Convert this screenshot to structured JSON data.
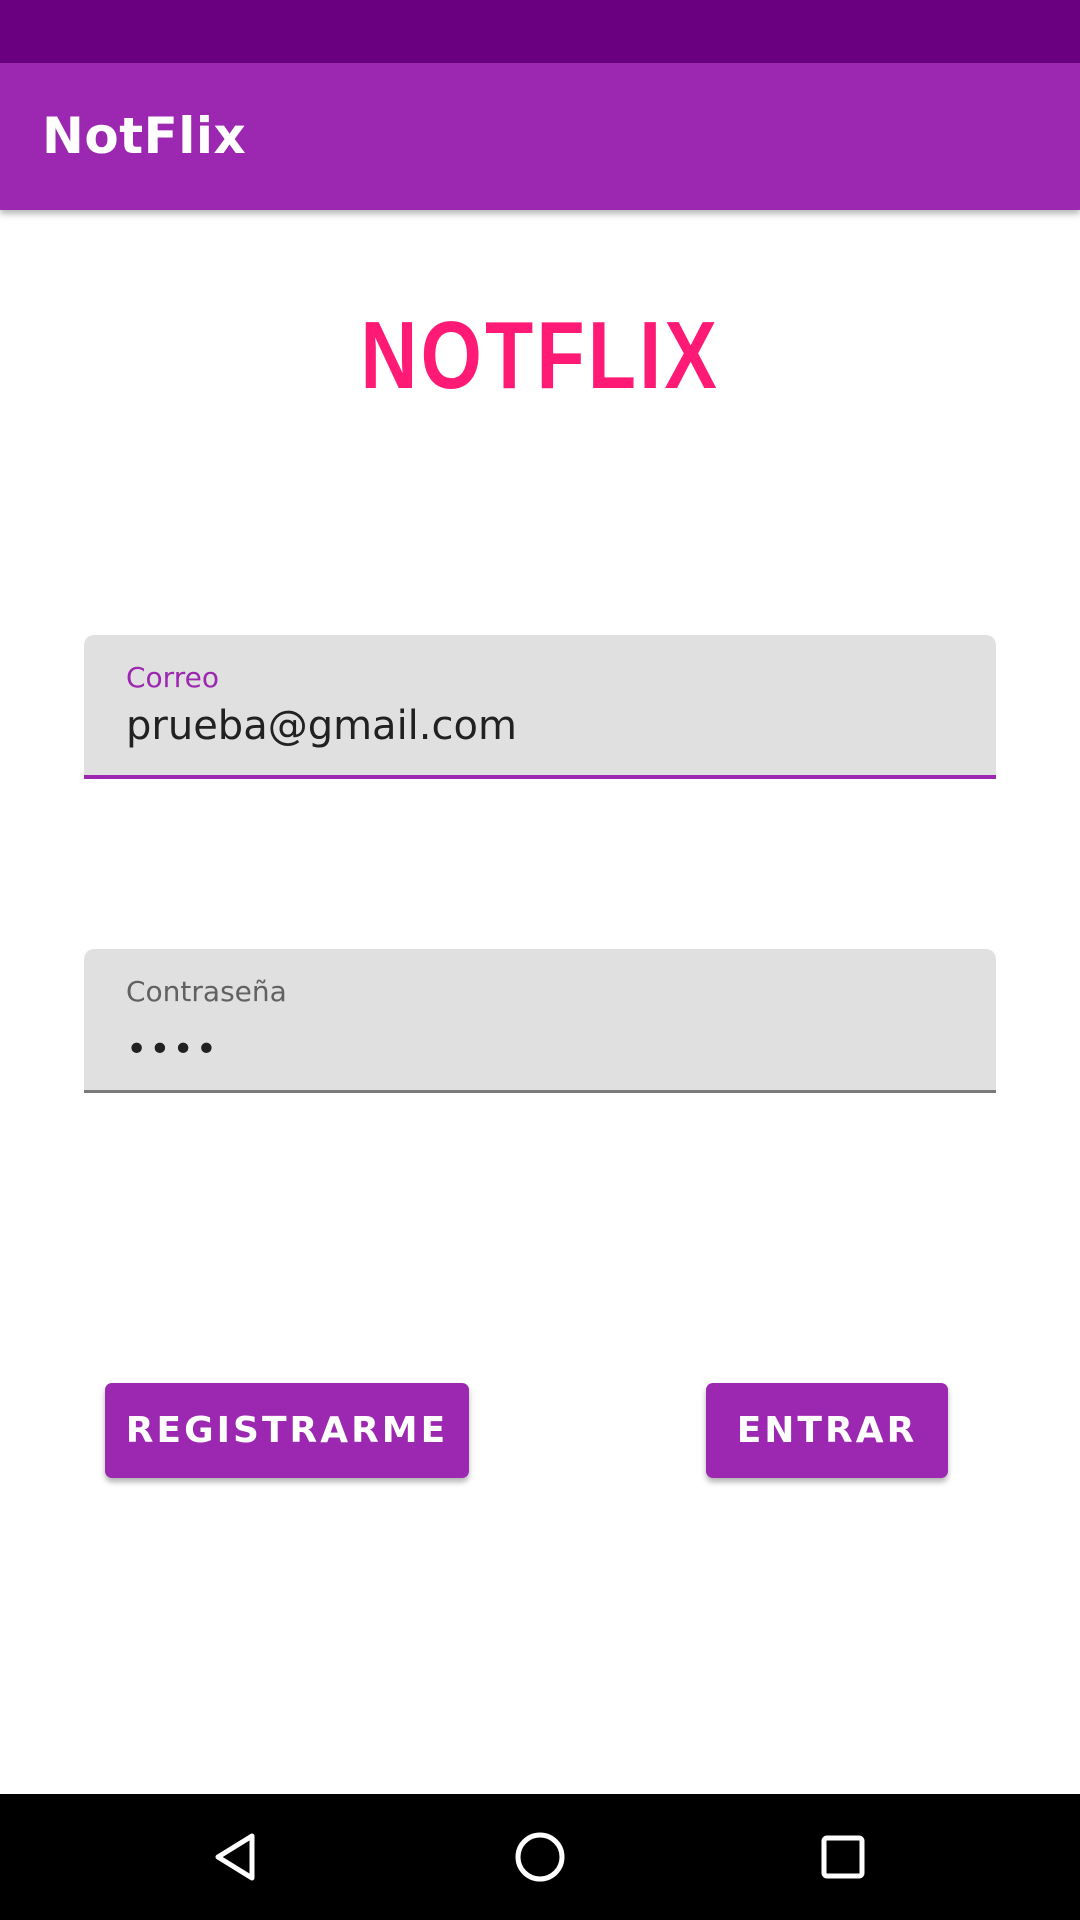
{
  "app_bar": {
    "title": "NotFlix"
  },
  "logo": {
    "text": "NOTFLIX",
    "color": "#ff1a75"
  },
  "email_field": {
    "label": "Correo",
    "value": "prueba@gmail.com"
  },
  "password_field": {
    "label": "Contraseña",
    "masked_value": "••••"
  },
  "buttons": {
    "register_label": "REGISTRARME",
    "login_label": "ENTRAR"
  },
  "nav_bar": {
    "icons": [
      "back-icon",
      "home-icon",
      "recents-icon"
    ]
  },
  "colors": {
    "primary": "#9c27b0",
    "status_bar": "#6a0080",
    "field_background": "#e0e0e0"
  }
}
